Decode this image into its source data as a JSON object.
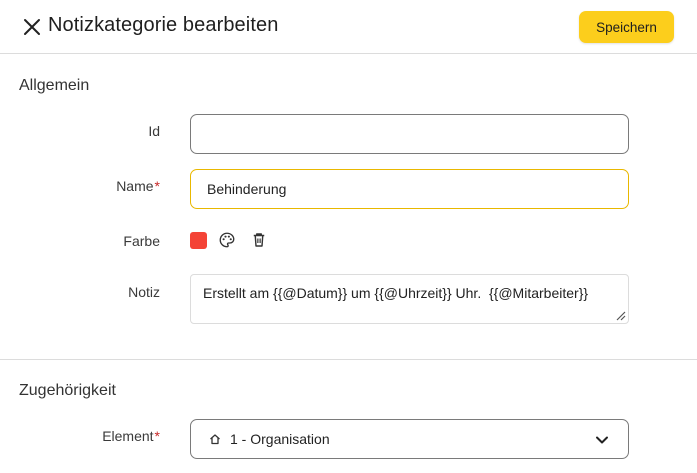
{
  "header": {
    "title": "Notizkategorie bearbeiten",
    "save_label": "Speichern",
    "close_icon": "close-icon"
  },
  "general": {
    "section_title": "Allgemein",
    "id_label": "Id",
    "id_value": "",
    "name_label": "Name",
    "name_required": "*",
    "name_value": "Behinderung",
    "color_label": "Farbe",
    "color_value": "#f44336",
    "palette_icon": "palette-icon",
    "delete_icon": "trash-icon",
    "note_label": "Notiz",
    "note_value": "Erstellt am {{@Datum}} um {{@Uhrzeit}} Uhr.  {{@Mitarbeiter}}"
  },
  "membership": {
    "section_title": "Zugehörigkeit",
    "element_label": "Element",
    "element_required": "*",
    "element_value": "1 - Organisation",
    "element_icon": "home-icon",
    "chevron_icon": "chevron-down-icon"
  },
  "colors": {
    "accent": "#fcce1c",
    "focus_border": "#e9b800",
    "required": "#c62828",
    "swatch": "#f44336"
  }
}
